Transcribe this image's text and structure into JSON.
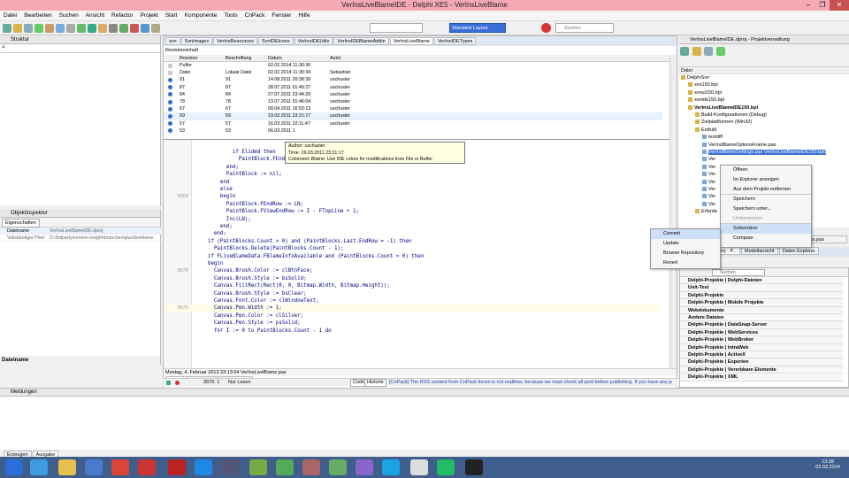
{
  "window": {
    "title": "VerInsLiveBlameIDE - Delphi XE5 - VerInsLiveBlame",
    "minimize": "–",
    "maximize": "❐",
    "close": "✕"
  },
  "menu": [
    "Datei",
    "Bearbeiten",
    "Suchen",
    "Ansicht",
    "Refactor",
    "Projekt",
    "Start",
    "Komponente",
    "Tools",
    "CnPack",
    "Fenster",
    "Hilfe"
  ],
  "toolbar": {
    "layout_select": "Standard Layout",
    "search_placeholder": "Suchen"
  },
  "structure": {
    "title": "Struktur"
  },
  "inspector": {
    "title": "Objektinspektor",
    "tab": "Eigenschaften",
    "rows": [
      {
        "name": "Dateiname",
        "value": "VerInsLiveBlameIDE.dproj"
      },
      {
        "name": "Vollständiger Pfad",
        "value": "D:\\3rdparty\\version insight\\branches\\plus\\liveblame"
      }
    ],
    "footer": "Dateiname"
  },
  "editor_tabs": [
    "svn",
    "SvnImages",
    "VerInsResources",
    "SvnIDEIcons",
    "VerInsIDEUtils",
    "VerInsIDEBlameAddin",
    "VerInsLiveBlame",
    "VerInsIDETypes"
  ],
  "revisions": {
    "label": "Revisionsinhalt",
    "headers": [
      "Revision",
      "Beschriftung",
      "Datum",
      "Autor"
    ],
    "rows": [
      {
        "rev": "Puffer",
        "label": "",
        "date": "02.02.2014 11:30:36",
        "author": ""
      },
      {
        "rev": "Datei",
        "label": "Lokale Datei",
        "date": "02.02.2014 11:30:34",
        "author": "Sebastian"
      },
      {
        "rev": "91",
        "label": "91",
        "date": "14.08.2011 20:38:39",
        "author": "uschuster"
      },
      {
        "rev": "87",
        "label": "87",
        "date": "28.07.2011 01:49:27",
        "author": "uschuster"
      },
      {
        "rev": "84",
        "label": "84",
        "date": "27.07.2011 23:44:29",
        "author": "uschuster"
      },
      {
        "rev": "78",
        "label": "78",
        "date": "13.07.2011 01:46:04",
        "author": "uschuster"
      },
      {
        "rev": "67",
        "label": "67",
        "date": "09.04.2011 16:53:13",
        "author": "uschuster"
      },
      {
        "rev": "59",
        "label": "59",
        "date": "19.03.2011 23:21:17",
        "author": "uschuster"
      },
      {
        "rev": "57",
        "label": "57",
        "date": "16.03.2011 22:11:47",
        "author": "uschuster"
      },
      {
        "rev": "53",
        "label": "53",
        "date": "06.03.2011 1",
        "author": ""
      }
    ]
  },
  "tooltip": {
    "line1": "Author: uschuster",
    "line2": "Time: 19.03.2011 23:21:17",
    "line3": "Comment: Blame: Use IDE colors for modifications from File or Buffer"
  },
  "code": {
    "lines": [
      {
        "n": "",
        "t": "            if Elided then"
      },
      {
        "n": "",
        "t": "              PaintBlock.FEndRow := LN;"
      },
      {
        "n": "",
        "t": "          end;"
      },
      {
        "n": "",
        "t": "          PaintBlock := nil;"
      },
      {
        "n": "",
        "t": "        end"
      },
      {
        "n": "",
        "t": "        else"
      },
      {
        "n": "3960",
        "t": "        begin"
      },
      {
        "n": "",
        "t": "          PaintBlock.FEndRow := LN;"
      },
      {
        "n": "",
        "t": "          PaintBlock.FViewEndRow := I - FTopLine + 1;"
      },
      {
        "n": "",
        "t": "          Inc(LN);"
      },
      {
        "n": "",
        "t": "        end;"
      },
      {
        "n": "",
        "t": "      end;"
      },
      {
        "n": "",
        "t": "    if (PaintBlocks.Count > 0) and (PaintBlocks.Last.EndRow = -1) then"
      },
      {
        "n": "",
        "t": "      PaintBlocks.Delete(PaintBlocks.Count - 1);"
      },
      {
        "n": "",
        "t": "    if FLiveBlameData.FBlameInfoAvailable and (PaintBlocks.Count > 0) then"
      },
      {
        "n": "",
        "t": "    begin"
      },
      {
        "n": "3970",
        "t": "      Canvas.Brush.Color := clBtnFace;"
      },
      {
        "n": "",
        "t": "      Canvas.Brush.Style := bsSolid;"
      },
      {
        "n": "",
        "t": "      Canvas.FillRect(Rect(0, 0, Bitmap.Width, Bitmap.Height));"
      },
      {
        "n": "",
        "t": "      Canvas.Brush.Style := bsClear;"
      },
      {
        "n": "",
        "t": "      Canvas.Font.Color := clWindowText;"
      },
      {
        "n": "3975",
        "t": "      Canvas.Pen.Width := 1;"
      },
      {
        "n": "",
        "t": "      Canvas.Pen.Color := clSilver;"
      },
      {
        "n": "",
        "t": "      Canvas.Pen.Style := psSolid;"
      },
      {
        "n": "",
        "t": "      for I := 0 to PaintBlocks.Count - 1 do"
      }
    ]
  },
  "editor_status": {
    "date_line": "Montag, 4. Februar 2013 23:13:04  VerInsLiveBlame.pas",
    "tabs": [
      "Inhalt",
      "Information",
      "Unterschiede"
    ],
    "position": "3975: 1",
    "mode": "Nur Lesen",
    "code_tab": "Code",
    "history_tab": "Historie",
    "news": "[CnPack] The RSS content from CnPack forum is not realtime, because we must check all post before publishing. If you have any pro..."
  },
  "project_manager": {
    "title": "VerInsLiveBlameIDE.dproj - Projektverwaltung",
    "header": "Datei",
    "items": [
      {
        "indent": 0,
        "text": "DelphiSvn",
        "bold": false
      },
      {
        "indent": 1,
        "text": "svn150.bpl",
        "bold": false
      },
      {
        "indent": 1,
        "text": "svnui150.bpl",
        "bold": false
      },
      {
        "indent": 1,
        "text": "svnide150.bpl",
        "bold": false
      },
      {
        "indent": 1,
        "text": "VerInsLiveBlameIDE150.bpl",
        "bold": true
      },
      {
        "indent": 2,
        "text": "Build-Konfigurationen (Debug)",
        "bold": false
      },
      {
        "indent": 2,
        "text": "Zielplattformen (Win32)",
        "bold": false
      },
      {
        "indent": 2,
        "text": "Enthält",
        "bold": false
      },
      {
        "indent": 3,
        "text": "textdiff",
        "bold": false
      },
      {
        "indent": 3,
        "text": "VerInsBlameOptionsFrame.pas",
        "bold": false
      },
      {
        "indent": 3,
        "text": "VerInsBlameSettings.pas  VerInsLiveBlameIDE150.bpl)",
        "bold": false,
        "selected": true
      },
      {
        "indent": 3,
        "text": "Ver",
        "bold": false
      },
      {
        "indent": 3,
        "text": "Ver",
        "bold": false
      },
      {
        "indent": 3,
        "text": "Ver",
        "bold": false
      },
      {
        "indent": 3,
        "text": "Ver",
        "bold": false
      },
      {
        "indent": 3,
        "text": "Ver",
        "bold": false
      },
      {
        "indent": 3,
        "text": "Ver",
        "bold": false
      },
      {
        "indent": 3,
        "text": "Ver",
        "bold": false
      },
      {
        "indent": 2,
        "text": "Erforde",
        "bold": false
      }
    ],
    "bottom_tabs": [
      "..iveBlameIDE.dproj - P...",
      "Modellansicht",
      "Daten-Explorer"
    ],
    "side_label": "ameSettings.pas"
  },
  "context_menu": {
    "items": [
      "Öffnen",
      "Im Explorer anzeigen",
      "Aus dem Projekt entfernen",
      "Speichern",
      "Speichern unter...",
      "Umbenennen",
      "Subversion",
      "Compare"
    ]
  },
  "submenu": {
    "items": [
      "Commit",
      "Update",
      "Browse Repository",
      "Revert"
    ]
  },
  "palette": {
    "search_placeholder": "Suchen",
    "groups": [
      "Delphi-Projekte | Delphi-Dateien",
      "Unit-Test",
      "Delphi-Projekte",
      "Delphi-Projekte | Mobile Projekte",
      "Webdokumente",
      "Andere Dateien",
      "Delphi-Projekte | DataSnap-Server",
      "Delphi-Projekte | WebServices",
      "Delphi-Projekte | WebBroker",
      "Delphi-Projekte | IntraWeb",
      "Delphi-Projekte | ActiveX",
      "Delphi-Projekte | Experten",
      "Delphi-Projekte | Vererbbare Elemente",
      "Delphi-Projekte | XML"
    ]
  },
  "messages": {
    "title": "Meldungen"
  },
  "bottom_tabs": [
    "Erzeugen",
    "Ausgabe"
  ],
  "clock": {
    "time": "13:28",
    "date": "02.02.2014"
  }
}
